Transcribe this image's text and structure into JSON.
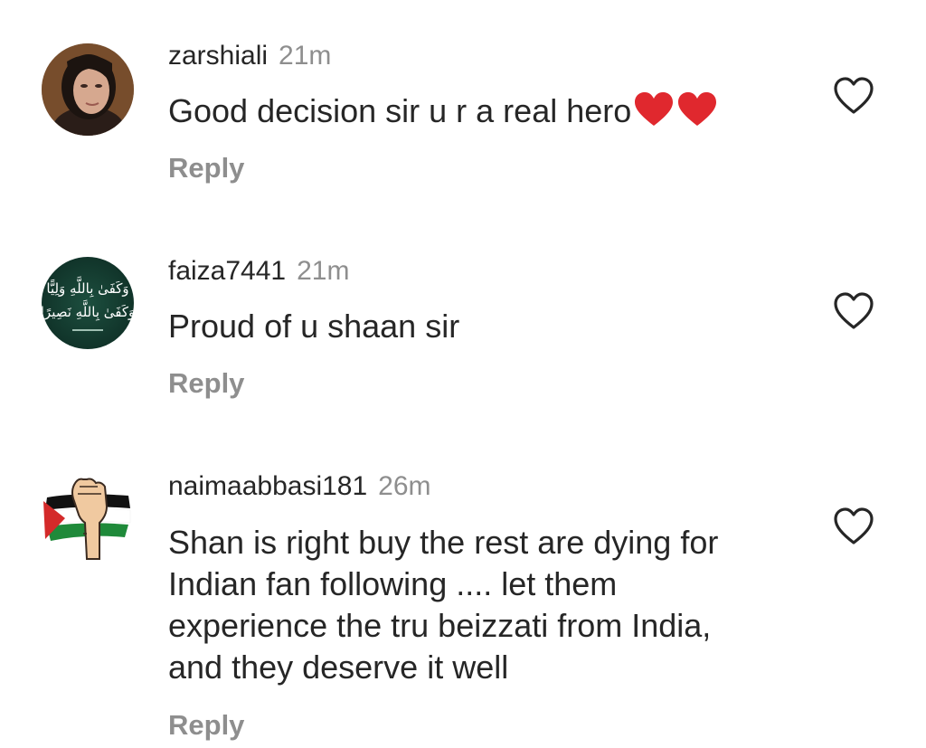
{
  "comments": [
    {
      "username": "zarshiali",
      "time": "21m",
      "text": "Good decision sir u r a real hero",
      "reply_label": "Reply"
    },
    {
      "username": "faiza7441",
      "time": "21m",
      "text": "Proud of u shaan sir",
      "reply_label": "Reply",
      "avatar_text_line1": "وَكَفَىٰ بِاللَّهِ وَلِيًّا",
      "avatar_text_line2": "وَكَفَىٰ بِاللَّهِ نَصِيرًا"
    },
    {
      "username": "naimaabbasi181",
      "time": "26m",
      "text_lines": [
        "Shan is right buy the rest are dying for",
        "Indian fan following .... let them",
        "experience the tru beizzati from India,",
        "and they deserve it well"
      ],
      "reply_label": "Reply"
    }
  ],
  "icons": {
    "like": "heart-outline-icon",
    "emoji": "red-heart-emoji"
  },
  "colors": {
    "text": "#262626",
    "secondary": "#8e8e8e",
    "heart_emoji": "#e0282e"
  }
}
